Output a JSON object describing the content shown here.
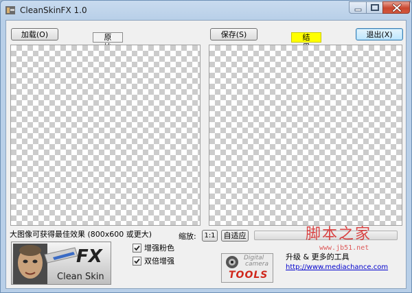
{
  "window": {
    "title": "CleanSkinFX 1.0"
  },
  "toolbar": {
    "load_label": "加载(O)",
    "original_tag": "原 始",
    "save_label": "保存(S)",
    "result_tag": "结 果",
    "exit_label": "退出(X)"
  },
  "footer": {
    "hint": "大图像可获得最佳效果  (800x600 或更大)",
    "zoom_label": "缩放:",
    "zoom_1to1": "1:1",
    "zoom_fit": "自适应",
    "progress": 0.0,
    "option_pink": "增强粉色",
    "option_pink_checked": true,
    "option_double": "双倍增强",
    "option_double_checked": true,
    "upgrade_text": "升级 & 更多的工具",
    "link": "http://www.mediachance.com"
  },
  "logo": {
    "fx": "FX",
    "name": "Clean Skin"
  },
  "tools_logo": {
    "line1": "Digital",
    "line2": "camera",
    "line3": "TOOLS"
  },
  "watermark": {
    "text": "脚本之家",
    "url": "www.jb51.net"
  },
  "colors": {
    "result_tag": "#ffff00",
    "titlebar": "#c9dbef",
    "close": "#c9472f"
  }
}
